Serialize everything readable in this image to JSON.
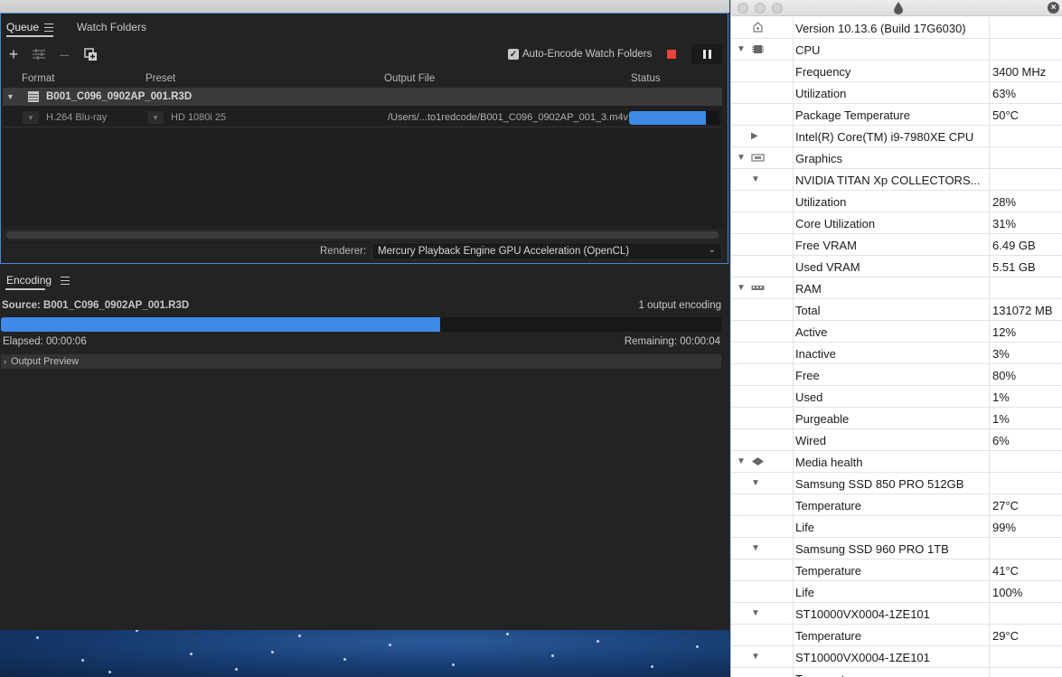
{
  "encoder": {
    "tabs": [
      {
        "label": "Queue",
        "active": true
      },
      {
        "label": "Watch Folders",
        "active": false
      }
    ],
    "toolbar": {
      "auto_encode_label": "Auto-Encode Watch Folders",
      "auto_encode_checked": true
    },
    "columns": {
      "format": "Format",
      "preset": "Preset",
      "output": "Output File",
      "status": "Status"
    },
    "queue_item": {
      "source": "B001_C096_0902AP_001.R3D",
      "format": "H.264 Blu-ray",
      "preset": "HD 1080i 25",
      "output": "/Users/...to1redcode/B001_C096_0902AP_001_3.m4v",
      "progress": 0.85
    },
    "renderer": {
      "label": "Renderer:",
      "value": "Mercury Playback Engine GPU Acceleration (OpenCL)"
    },
    "encoding": {
      "tab": "Encoding",
      "source": "Source: B001_C096_0902AP_001.R3D",
      "count": "1 output encoding",
      "elapsed": "Elapsed: 00:00:06",
      "remaining": "Remaining: 00:00:04",
      "progress": 0.61,
      "preview": "Output Preview"
    }
  },
  "sysinfo": {
    "rows": [
      {
        "label": "Version 10.13.6 (Build 17G6030)",
        "value": "",
        "tri": "",
        "icon": "apple-icon"
      },
      {
        "label": "CPU",
        "value": "",
        "tri": "down",
        "icon": "cpu-chip-icon"
      },
      {
        "label": "Frequency",
        "value": "3400 MHz",
        "tri": "",
        "icon": ""
      },
      {
        "label": "Utilization",
        "value": "63%",
        "tri": "",
        "icon": ""
      },
      {
        "label": "Package Temperature",
        "value": "50°C",
        "tri": "",
        "icon": ""
      },
      {
        "label": "Intel(R) Core(TM) i9-7980XE CPU",
        "value": "",
        "tri": "right-indent",
        "icon": ""
      },
      {
        "label": "Graphics",
        "value": "",
        "tri": "down",
        "icon": "graphics-card-icon"
      },
      {
        "label": "NVIDIA TITAN Xp COLLECTORS...",
        "value": "",
        "tri": "down-indent",
        "icon": ""
      },
      {
        "label": "Utilization",
        "value": "28%",
        "tri": "",
        "icon": ""
      },
      {
        "label": "Core Utilization",
        "value": "31%",
        "tri": "",
        "icon": ""
      },
      {
        "label": "Free VRAM",
        "value": "6.49 GB",
        "tri": "",
        "icon": ""
      },
      {
        "label": "Used VRAM",
        "value": "5.51 GB",
        "tri": "",
        "icon": ""
      },
      {
        "label": "RAM",
        "value": "",
        "tri": "down",
        "icon": "ram-icon"
      },
      {
        "label": "Total",
        "value": "131072 MB",
        "tri": "",
        "icon": ""
      },
      {
        "label": "Active",
        "value": "12%",
        "tri": "",
        "icon": ""
      },
      {
        "label": "Inactive",
        "value": "3%",
        "tri": "",
        "icon": ""
      },
      {
        "label": "Free",
        "value": "80%",
        "tri": "",
        "icon": ""
      },
      {
        "label": "Used",
        "value": "1%",
        "tri": "",
        "icon": ""
      },
      {
        "label": "Purgeable",
        "value": "1%",
        "tri": "",
        "icon": ""
      },
      {
        "label": "Wired",
        "value": "6%",
        "tri": "",
        "icon": ""
      },
      {
        "label": "Media health",
        "value": "",
        "tri": "down",
        "icon": "disk-icon"
      },
      {
        "label": "Samsung SSD 850 PRO 512GB",
        "value": "",
        "tri": "down-indent",
        "icon": ""
      },
      {
        "label": "Temperature",
        "value": "27°C",
        "tri": "",
        "icon": ""
      },
      {
        "label": "Life",
        "value": "99%",
        "tri": "",
        "icon": ""
      },
      {
        "label": "Samsung SSD 960 PRO 1TB",
        "value": "",
        "tri": "down-indent",
        "icon": ""
      },
      {
        "label": "Temperature",
        "value": "41°C",
        "tri": "",
        "icon": ""
      },
      {
        "label": "Life",
        "value": "100%",
        "tri": "",
        "icon": ""
      },
      {
        "label": "ST10000VX0004-1ZE101",
        "value": "",
        "tri": "down-indent",
        "icon": ""
      },
      {
        "label": "Temperature",
        "value": "29°C",
        "tri": "",
        "icon": ""
      },
      {
        "label": "ST10000VX0004-1ZE101",
        "value": "",
        "tri": "down-indent",
        "icon": ""
      },
      {
        "label": "Temperature",
        "value": "",
        "tri": "",
        "icon": ""
      }
    ]
  }
}
